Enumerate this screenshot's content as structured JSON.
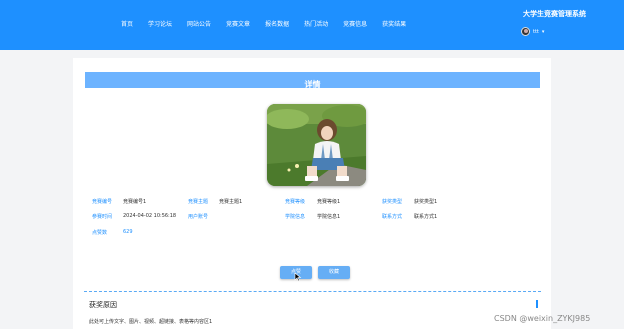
{
  "nav": {
    "items": [
      "首页",
      "学习论坛",
      "网站公告",
      "竞赛文章",
      "报名数据",
      "热门活动",
      "竞赛信息",
      "获奖结果"
    ],
    "site_title": "大学生竞赛管理系统",
    "user_name": "ttt",
    "caret": "▾"
  },
  "detail": {
    "title": "详情",
    "fields": {
      "f1": {
        "label": "竞赛编号",
        "value": "竞赛编号1"
      },
      "f2": {
        "label": "竞赛主题",
        "value": "竞赛主题1"
      },
      "f3": {
        "label": "竞赛等级",
        "value": "竞赛等级1"
      },
      "f4": {
        "label": "获奖类型",
        "value": "获奖类型1"
      },
      "f5": {
        "label": "参赛时间",
        "value": "2024-04-02 10:56:18"
      },
      "f6": {
        "label": "用户账号",
        "value": ""
      },
      "f7": {
        "label": "学院信息",
        "value": "学院信息1"
      },
      "f8": {
        "label": "联系方式",
        "value": "联系方式1"
      },
      "f9": {
        "label": "点赞数",
        "value": "629"
      }
    },
    "buttons": {
      "like": "点赞",
      "favorite": "收藏"
    }
  },
  "section": {
    "title": "获奖原因",
    "body": "此处可上传文字、图片、视频、超链接、表格等内容区1"
  },
  "watermark": "CSDN @weixin_ZYKJ985",
  "colors": {
    "accent": "#1e90ff",
    "header_bar": "#6cb3ff"
  }
}
